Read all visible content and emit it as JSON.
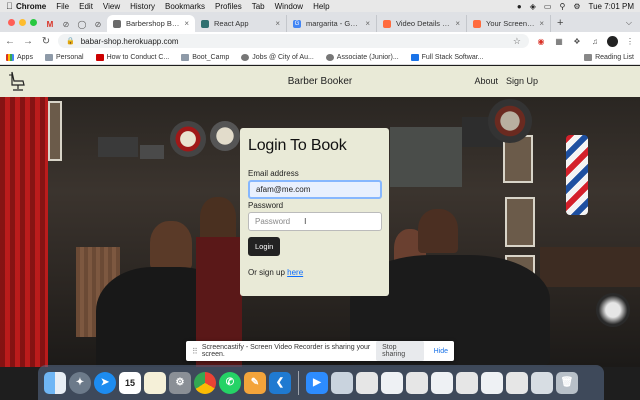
{
  "menubar": {
    "app": "Chrome",
    "items": [
      "File",
      "Edit",
      "View",
      "History",
      "Bookmarks",
      "Profiles",
      "Tab",
      "Window",
      "Help"
    ],
    "clock": "Tue 7:01 PM"
  },
  "tabs": [
    {
      "label": "Barbershop Booker",
      "active": true,
      "color": "#6b6b6b"
    },
    {
      "label": "React App",
      "active": false,
      "color": "#2f6f6f"
    },
    {
      "label": "margarita - Google S",
      "active": false,
      "color": "#4285f4"
    },
    {
      "label": "Video Details - Scre",
      "active": false,
      "color": "#ff6b3d"
    },
    {
      "label": "Your Screencasts - S",
      "active": false,
      "color": "#ff6b3d"
    }
  ],
  "omnibox": {
    "url": "babar-shop.herokuapp.com"
  },
  "bookmarks": [
    "Apps",
    "Personal",
    "How to Conduct C...",
    "Boot_Camp",
    "Jobs @ City of Au...",
    "Associate (Junior)...",
    "Full Stack Softwar..."
  ],
  "reading_list": "Reading List",
  "app": {
    "brand": "Barber Booker",
    "nav": {
      "about": "About",
      "signup": "Sign Up"
    }
  },
  "login": {
    "title": "Login To Book",
    "email_label": "Email address",
    "email_value": "afam@me.com",
    "password_label": "Password",
    "password_placeholder": "Password",
    "button": "Login",
    "signup_prefix": "Or sign up",
    "signup_link": "here"
  },
  "share_banner": {
    "text": "Screencastify - Screen Video Recorder is sharing your screen.",
    "stop": "Stop sharing",
    "hide": "Hide"
  },
  "dock": {
    "calendar_day": "15",
    "icons": [
      "finder-icon",
      "launchpad-icon",
      "safari-icon",
      "calendar-icon",
      "notes-icon",
      "system-preferences-icon",
      "chrome-icon",
      "whatsapp-icon",
      "pages-icon",
      "vscode-icon",
      "zoom-icon",
      "preview-icon",
      "documents-icon",
      "trash-icon"
    ]
  }
}
